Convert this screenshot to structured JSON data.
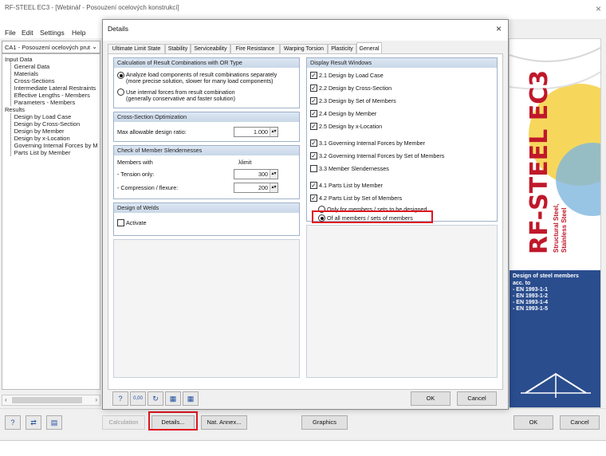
{
  "window": {
    "title": "RF-STEEL EC3 - [Webinář - Posouzení ocelových konstrukcí]",
    "close": "×"
  },
  "menu": [
    "File",
    "Edit",
    "Settings",
    "Help"
  ],
  "case_combo": "CA1 - Posouzení ocelových prut",
  "tree": {
    "input_header": "Input Data",
    "input_items": [
      "General Data",
      "Materials",
      "Cross-Sections",
      "Intermediate Lateral Restraints",
      "Effective Lengths - Members",
      "Parameters - Members"
    ],
    "results_header": "Results",
    "results_items": [
      "Design by Load Case",
      "Design by Cross-Section",
      "Design by Member",
      "Design by x-Location",
      "Governing Internal Forces by M",
      "Parts List by Member"
    ]
  },
  "dialog": {
    "title": "Details",
    "close": "×",
    "tabs": [
      "Ultimate Limit State",
      "Stability",
      "Serviceability",
      "Fire Resistance",
      "Warping Torsion",
      "Plasticity",
      "General"
    ],
    "active_tab": "General",
    "result_combos": {
      "header": "Calculation of Result Combinations with OR Type",
      "opt1_line1": "Analyze load components of result combinations separately",
      "opt1_line2": "(more precise solution, slower for many load components)",
      "opt2_line1": "Use internal forces from result combination",
      "opt2_line2": "(generally conservative and faster solution)",
      "selected": "opt1"
    },
    "cs_opt": {
      "header": "Cross-Section Optimization",
      "label": "Max allowable design ratio:",
      "value": "1.000"
    },
    "slenderness": {
      "header": "Check of Member Slendernesses",
      "members_with": "Members with",
      "lambda_header": "λlimit",
      "tension_label": "- Tension only:",
      "tension_value": "300",
      "compression_label": "- Compression / flexure:",
      "compression_value": "200"
    },
    "welds": {
      "header": "Design of Welds",
      "activate_label": "Activate",
      "checked": false
    },
    "display": {
      "header": "Display Result Windows",
      "items": [
        {
          "label": "2.1 Design by Load Case",
          "checked": "✓"
        },
        {
          "label": "2.2 Design by Cross-Section",
          "checked": "✓"
        },
        {
          "label": "2.3 Design by Set of Members",
          "checked": "✓"
        },
        {
          "label": "2.4 Design by Member",
          "checked": "✓"
        },
        {
          "label": "2.5 Design by x-Location",
          "checked": "✓"
        },
        {
          "label": "3.1 Governing Internal Forces by Member",
          "checked": "✓"
        },
        {
          "label": "3.2 Governing Internal Forces by Set of Members",
          "checked": "✓"
        },
        {
          "label": "3.3 Member Slendernesses",
          "checked": ""
        },
        {
          "label": "4.1 Parts List by Member",
          "checked": "✓"
        },
        {
          "label": "4.2 Parts List by Set of Members",
          "checked": "✓"
        }
      ],
      "radio_only": "Only for members / sets to be designed",
      "radio_all": "Of all members / sets of members",
      "radio_selected": "all"
    },
    "ok": "OK",
    "cancel": "Cancel"
  },
  "bottom": {
    "calculation": "Calculation",
    "details": "Details...",
    "nat_annex": "Nat. Annex...",
    "graphics": "Graphics",
    "ok": "OK",
    "cancel": "Cancel"
  },
  "side": {
    "logo_text": "RF-STEEL EC3",
    "logo_sub1": "Structural Steel,",
    "logo_sub2": "Stainless Steel",
    "info_title": "Design of steel members",
    "info_acc": "acc. to",
    "info_norms": [
      "- EN 1993-1-1",
      "- EN 1993-1-2",
      "- EN 1993-1-4",
      "- EN 1993-1-5"
    ]
  },
  "colors": {
    "highlight": "#e0141e",
    "brand_blue": "#2a4d8e",
    "brand_red": "#c0182a"
  },
  "icons": [
    "help-icon",
    "decimal-icon",
    "info-icon",
    "export-icon",
    "import-icon"
  ]
}
